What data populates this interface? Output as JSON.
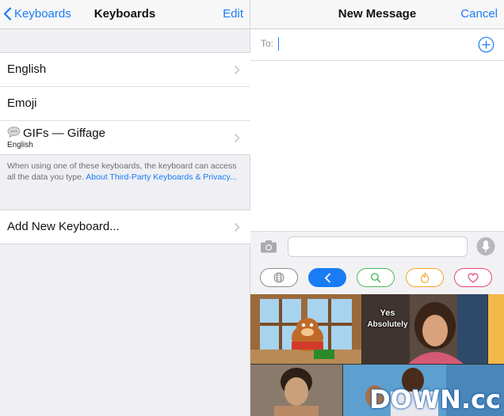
{
  "left_panel": {
    "nav": {
      "back_label": "Keyboards",
      "title": "Keyboards",
      "edit_label": "Edit"
    },
    "keyboards": [
      {
        "label": "English",
        "has_chevron": true
      },
      {
        "label": "Emoji",
        "has_chevron": false
      },
      {
        "label": "GIFs — Giffage",
        "sublabel": "English",
        "icon": "speech-bubble-icon",
        "has_chevron": true
      }
    ],
    "note_text": "When using one of these keyboards, the keyboard can access all the data you type. ",
    "note_link": "About Third-Party Keyboards & Privacy...",
    "add_keyboard_label": "Add New Keyboard..."
  },
  "right_panel": {
    "nav": {
      "title": "New Message",
      "cancel_label": "Cancel"
    },
    "to_label": "To:",
    "message_placeholder": "",
    "keyboard_pills": [
      {
        "icon": "globe-icon",
        "color": "#8e8e93"
      },
      {
        "icon": "back-arrow-icon",
        "color": "#1a7cf5",
        "active": true
      },
      {
        "icon": "search-icon",
        "color": "#4cbb5a"
      },
      {
        "icon": "fire-icon",
        "color": "#f5a623"
      },
      {
        "icon": "heart-icon",
        "color": "#e8467c"
      }
    ],
    "gif_captions": {
      "yes": "Yes",
      "absolutely": "Absolutely"
    }
  },
  "watermark": "DOWN.cc",
  "colors": {
    "accent": "#1a7cf5",
    "group_bg": "#efeff4"
  }
}
